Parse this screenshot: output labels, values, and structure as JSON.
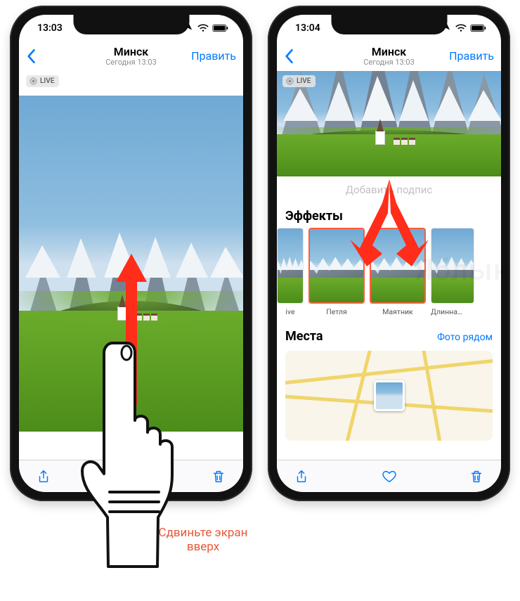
{
  "phone1": {
    "status": {
      "time": "13:03"
    },
    "nav": {
      "title": "Минск",
      "subtitle": "Сегодня 13:03",
      "edit": "Править"
    },
    "live_badge": "LIVE",
    "instruction": "Сдвиньте экран\nвверх"
  },
  "phone2": {
    "status": {
      "time": "13:04"
    },
    "nav": {
      "title": "Минск",
      "subtitle": "Сегодня 13:03",
      "edit": "Править"
    },
    "live_badge": "LIVE",
    "caption_placeholder": "Добавить подпис",
    "effects_heading": "Эффекты",
    "effects": [
      {
        "label": "ive"
      },
      {
        "label": "Петля"
      },
      {
        "label": "Маятник"
      },
      {
        "label": "Длинная выде"
      }
    ],
    "places": {
      "heading": "Места",
      "link": "Фото рядом"
    }
  },
  "watermark": "Яблык"
}
